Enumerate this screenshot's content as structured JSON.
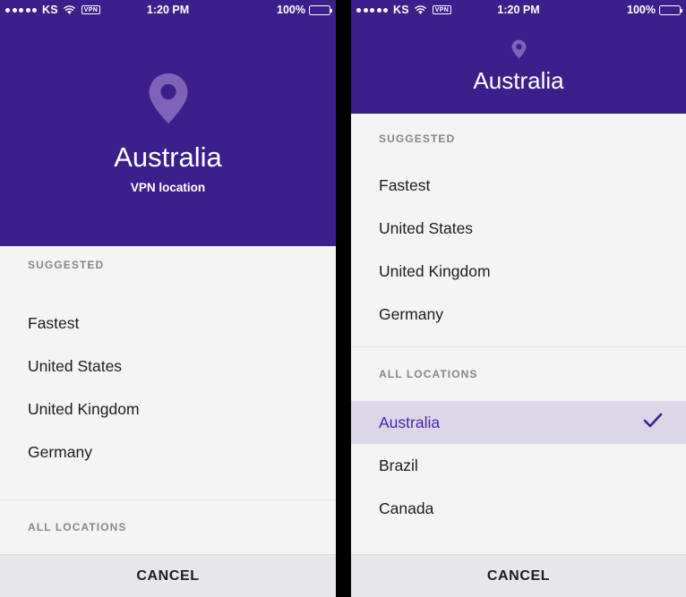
{
  "status_bar": {
    "signal_dots": 5,
    "carrier": "KS",
    "wifi_icon": "wifi-icon",
    "vpn_badge": "VPN",
    "time": "1:20 PM",
    "battery_percent": "100%",
    "battery_icon": "battery-full-icon"
  },
  "colors": {
    "header_purple": "#3d1f8c",
    "pin_purple": "#7e63b8",
    "selected_row_bg": "#dcd7e8",
    "selected_row_text": "#4b22a8",
    "check_purple": "#3d1f8c",
    "body_bg": "#f4f4f5",
    "cancel_bg": "#e7e7e9",
    "section_label": "#86868b"
  },
  "left_screen": {
    "header": {
      "pin_icon": "location-pin-icon",
      "title": "Australia",
      "subtitle": "VPN location"
    },
    "suggested_label": "SUGGESTED",
    "suggested_items": [
      {
        "label": "Fastest",
        "selected": false
      },
      {
        "label": "United States",
        "selected": false
      },
      {
        "label": "United Kingdom",
        "selected": false
      },
      {
        "label": "Germany",
        "selected": false
      }
    ],
    "all_locations_label": "ALL LOCATIONS",
    "cancel_label": "CANCEL"
  },
  "right_screen": {
    "header": {
      "pin_icon": "location-pin-icon",
      "title": "Australia"
    },
    "suggested_label": "SUGGESTED",
    "suggested_items": [
      {
        "label": "Fastest",
        "selected": false
      },
      {
        "label": "United States",
        "selected": false
      },
      {
        "label": "United Kingdom",
        "selected": false
      },
      {
        "label": "Germany",
        "selected": false
      }
    ],
    "all_locations_label": "ALL LOCATIONS",
    "all_locations_items": [
      {
        "label": "Australia",
        "selected": true,
        "check_icon": "checkmark-icon"
      },
      {
        "label": "Brazil",
        "selected": false
      },
      {
        "label": "Canada",
        "selected": false
      }
    ],
    "cancel_label": "CANCEL"
  }
}
